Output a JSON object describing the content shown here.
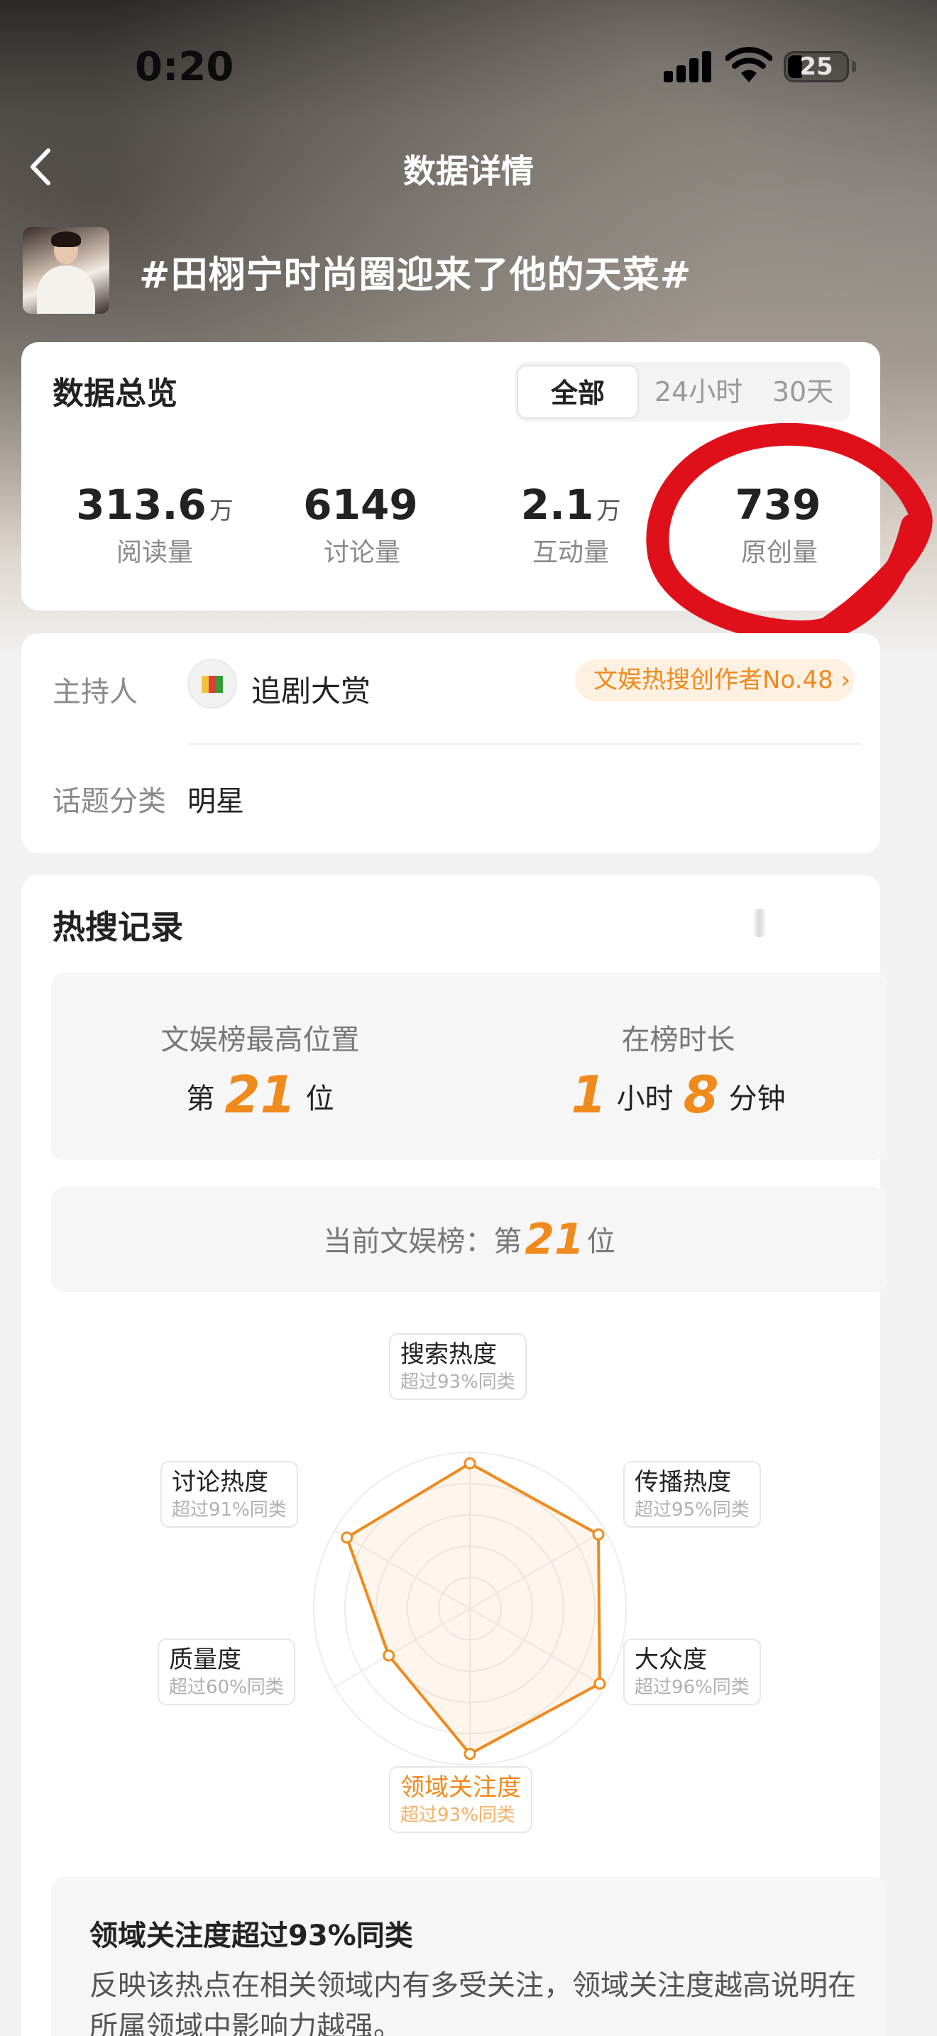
{
  "status_bar": {
    "time": "0:20",
    "battery": "25"
  },
  "nav": {
    "title": "数据详情"
  },
  "topic": {
    "title": "#田栩宁时尚圈迎来了他的天菜#"
  },
  "overview": {
    "title": "数据总览",
    "tabs": [
      {
        "label": "全部",
        "active": true
      },
      {
        "label": "24小时",
        "active": false
      },
      {
        "label": "30天",
        "active": false
      }
    ],
    "stats": [
      {
        "value": "313.6",
        "unit": "万",
        "label": "阅读量"
      },
      {
        "value": "6149",
        "unit": "",
        "label": "讨论量"
      },
      {
        "value": "2.1",
        "unit": "万",
        "label": "互动量"
      },
      {
        "value": "739",
        "unit": "",
        "label": "原创量"
      }
    ]
  },
  "host": {
    "label": "主持人",
    "name": "追剧大赏",
    "badge": "文娱热搜创作者No.48 ›",
    "category_label": "话题分类",
    "category_value": "明星"
  },
  "hot": {
    "title": "热搜记录",
    "rank_title": "文娱榜最高位置",
    "rank_prefix": "第",
    "rank_value": "21",
    "rank_suffix": "位",
    "duration_title": "在榜时长",
    "duration_hours": "1",
    "duration_hours_unit": "小时",
    "duration_minutes": "8",
    "duration_minutes_unit": "分钟",
    "current_prefix": "当前文娱榜：第",
    "current_value": "21",
    "current_suffix": "位"
  },
  "radar": {
    "axes": [
      {
        "name": "搜索热度",
        "sub": "超过93%同类",
        "value": 93
      },
      {
        "name": "传播热度",
        "sub": "超过95%同类",
        "value": 95
      },
      {
        "name": "大众度",
        "sub": "超过96%同类",
        "value": 96
      },
      {
        "name": "领域关注度",
        "sub": "超过93%同类",
        "value": 93,
        "highlight": true
      },
      {
        "name": "质量度",
        "sub": "超过60%同类",
        "value": 60
      },
      {
        "name": "讨论热度",
        "sub": "超过91%同类",
        "value": 91
      }
    ],
    "accent": "#f08a1c"
  },
  "explain": {
    "title": "领域关注度超过93%同类",
    "text": "反映该热点在相关领域内有多受关注，领域关注度越高说明在所属领域中影响力越强。"
  },
  "colors": {
    "accent": "#f08a1c",
    "annotation": "#e0101a"
  }
}
